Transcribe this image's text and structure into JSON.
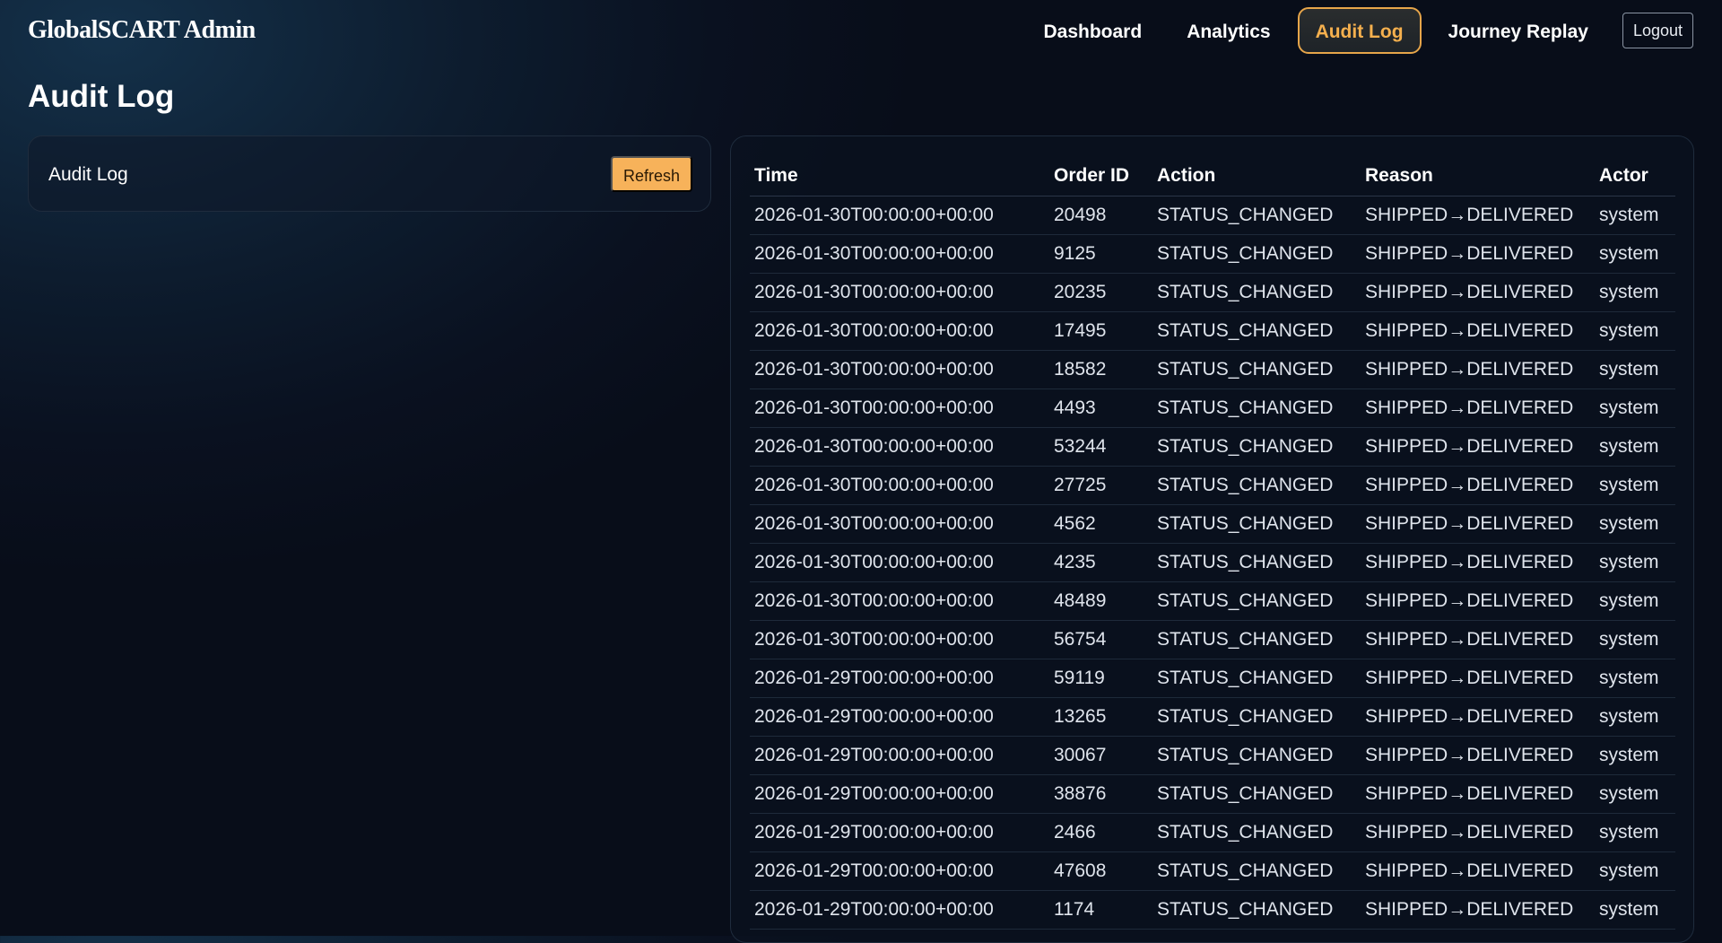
{
  "app": {
    "brand": "GlobalSCART Admin"
  },
  "nav": {
    "items": [
      {
        "label": "Dashboard",
        "active": false
      },
      {
        "label": "Analytics",
        "active": false
      },
      {
        "label": "Audit Log",
        "active": true
      },
      {
        "label": "Journey Replay",
        "active": false
      }
    ],
    "logout_label": "Logout"
  },
  "page": {
    "title": "Audit Log"
  },
  "left_panel": {
    "title": "Audit Log",
    "refresh_label": "Refresh"
  },
  "table": {
    "columns": [
      "Time",
      "Order ID",
      "Action",
      "Reason",
      "Actor"
    ],
    "rows": [
      [
        "2026-01-30T00:00:00+00:00",
        "20498",
        "STATUS_CHANGED",
        "SHIPPED→DELIVERED",
        "system"
      ],
      [
        "2026-01-30T00:00:00+00:00",
        "9125",
        "STATUS_CHANGED",
        "SHIPPED→DELIVERED",
        "system"
      ],
      [
        "2026-01-30T00:00:00+00:00",
        "20235",
        "STATUS_CHANGED",
        "SHIPPED→DELIVERED",
        "system"
      ],
      [
        "2026-01-30T00:00:00+00:00",
        "17495",
        "STATUS_CHANGED",
        "SHIPPED→DELIVERED",
        "system"
      ],
      [
        "2026-01-30T00:00:00+00:00",
        "18582",
        "STATUS_CHANGED",
        "SHIPPED→DELIVERED",
        "system"
      ],
      [
        "2026-01-30T00:00:00+00:00",
        "4493",
        "STATUS_CHANGED",
        "SHIPPED→DELIVERED",
        "system"
      ],
      [
        "2026-01-30T00:00:00+00:00",
        "53244",
        "STATUS_CHANGED",
        "SHIPPED→DELIVERED",
        "system"
      ],
      [
        "2026-01-30T00:00:00+00:00",
        "27725",
        "STATUS_CHANGED",
        "SHIPPED→DELIVERED",
        "system"
      ],
      [
        "2026-01-30T00:00:00+00:00",
        "4562",
        "STATUS_CHANGED",
        "SHIPPED→DELIVERED",
        "system"
      ],
      [
        "2026-01-30T00:00:00+00:00",
        "4235",
        "STATUS_CHANGED",
        "SHIPPED→DELIVERED",
        "system"
      ],
      [
        "2026-01-30T00:00:00+00:00",
        "48489",
        "STATUS_CHANGED",
        "SHIPPED→DELIVERED",
        "system"
      ],
      [
        "2026-01-30T00:00:00+00:00",
        "56754",
        "STATUS_CHANGED",
        "SHIPPED→DELIVERED",
        "system"
      ],
      [
        "2026-01-29T00:00:00+00:00",
        "59119",
        "STATUS_CHANGED",
        "SHIPPED→DELIVERED",
        "system"
      ],
      [
        "2026-01-29T00:00:00+00:00",
        "13265",
        "STATUS_CHANGED",
        "SHIPPED→DELIVERED",
        "system"
      ],
      [
        "2026-01-29T00:00:00+00:00",
        "30067",
        "STATUS_CHANGED",
        "SHIPPED→DELIVERED",
        "system"
      ],
      [
        "2026-01-29T00:00:00+00:00",
        "38876",
        "STATUS_CHANGED",
        "SHIPPED→DELIVERED",
        "system"
      ],
      [
        "2026-01-29T00:00:00+00:00",
        "2466",
        "STATUS_CHANGED",
        "SHIPPED→DELIVERED",
        "system"
      ],
      [
        "2026-01-29T00:00:00+00:00",
        "47608",
        "STATUS_CHANGED",
        "SHIPPED→DELIVERED",
        "system"
      ],
      [
        "2026-01-29T00:00:00+00:00",
        "1174",
        "STATUS_CHANGED",
        "SHIPPED→DELIVERED",
        "system"
      ]
    ]
  },
  "colors": {
    "accent": "#f7b25a",
    "active_nav_text": "#f5b04e",
    "background": "#0a1120"
  }
}
